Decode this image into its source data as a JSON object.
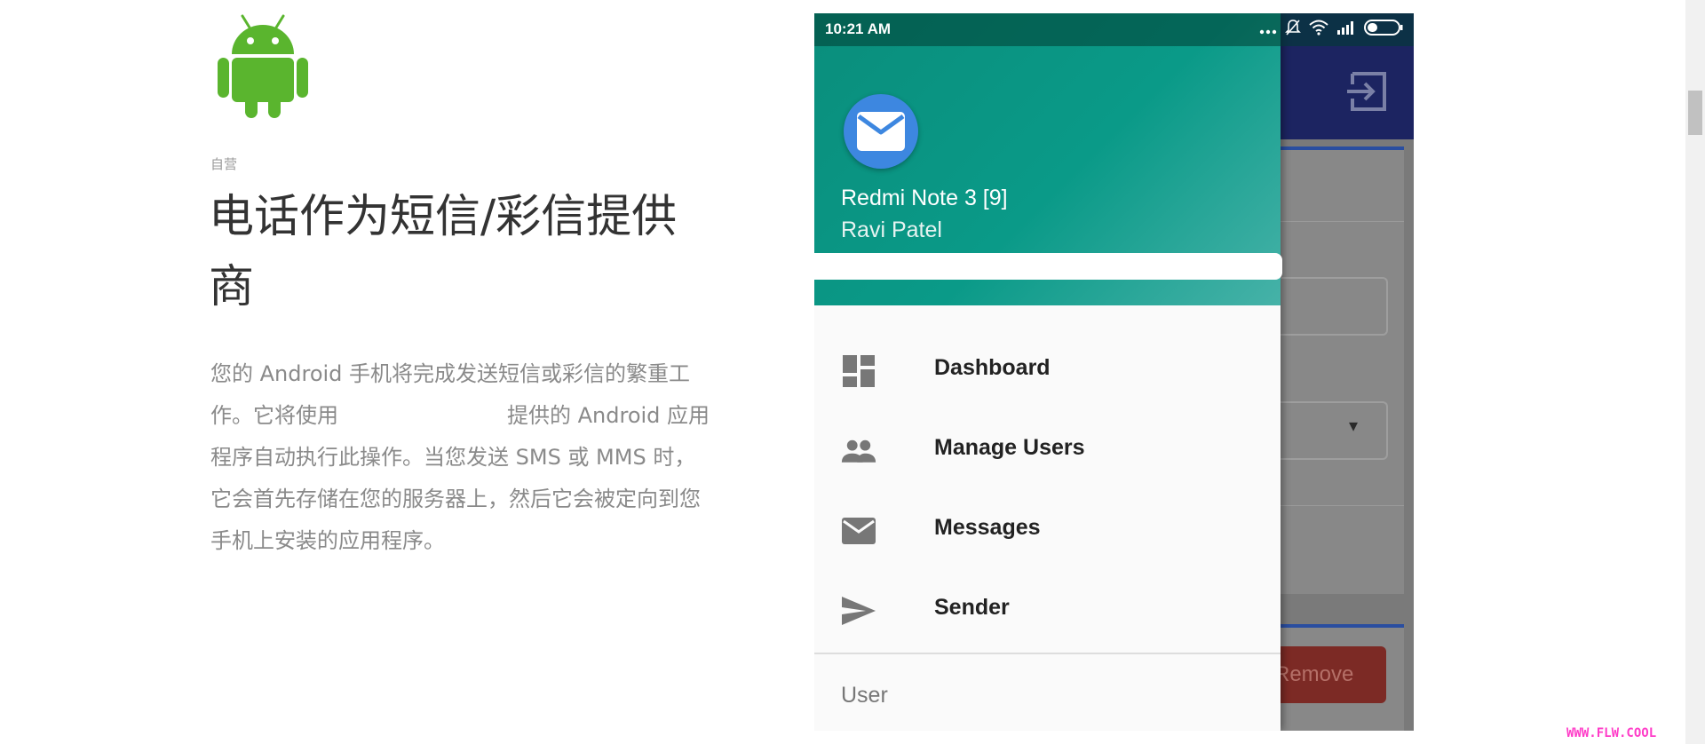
{
  "article": {
    "eyebrow": "自营",
    "headline": "电话作为短信/彩信提供商",
    "paragraph_before_gap": "您的 Android 手机将完成发送短信或彩信的繁重工作。它将使用",
    "paragraph_after_gap": "提供的 Android 应用程序自动执行此操作。当您发送 SMS 或 MMS 时，它会首先存储在您的服务器上，然后它会被定向到您手机上安装的应用程序。"
  },
  "phone": {
    "status_bar": {
      "time": "10:21 AM",
      "icons": [
        "more-dots-icon",
        "bell-muted-icon",
        "wifi-icon",
        "signal-icon",
        "battery-icon"
      ]
    },
    "drawer": {
      "device_name": "Redmi Note 3 [9]",
      "user_name": "Ravi Patel",
      "items": [
        {
          "icon": "dashboard-icon",
          "label": "Dashboard"
        },
        {
          "icon": "users-icon",
          "label": "Manage Users"
        },
        {
          "icon": "mail-icon",
          "label": "Messages"
        },
        {
          "icon": "send-icon",
          "label": "Sender"
        }
      ],
      "section_label": "User"
    },
    "background_app": {
      "remove_button": "Remove",
      "select_caret": "▾"
    }
  },
  "watermark": "WWW.FLW.COOL",
  "colors": {
    "android_green": "#3ddc84",
    "drawer_header": "#0a9a88",
    "app_topbar": "#1c2461",
    "avatar_blue": "#3d87e0"
  }
}
